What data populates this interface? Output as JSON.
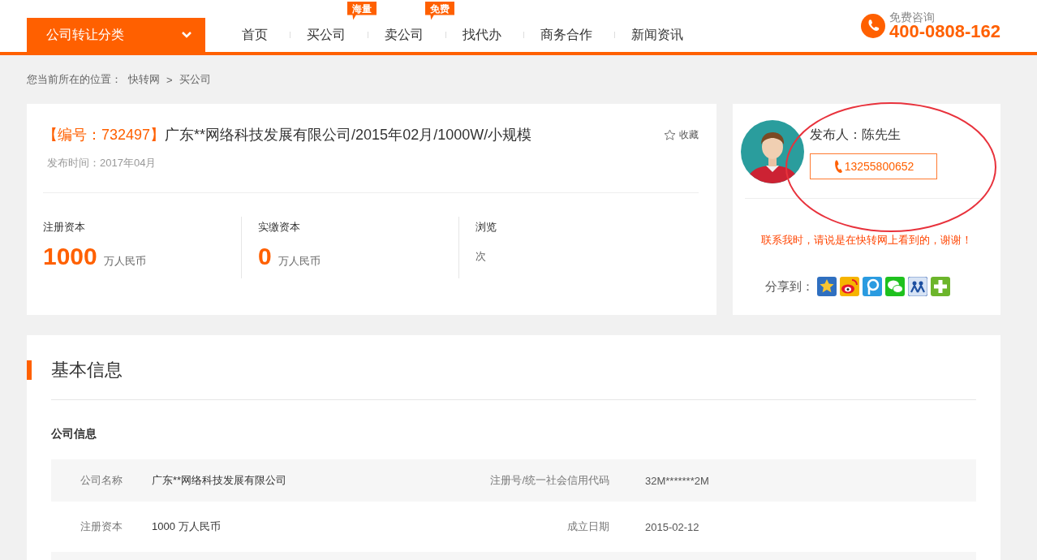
{
  "header": {
    "category_button": {
      "label": "公司转让分类"
    },
    "nav": [
      {
        "label": "首页"
      },
      {
        "label": "买公司",
        "badge": "海量"
      },
      {
        "label": "卖公司",
        "badge": "免费"
      },
      {
        "label": "找代办"
      },
      {
        "label": "商务合作"
      },
      {
        "label": "新闻资讯"
      }
    ],
    "hotline": {
      "caption": "免费咨询",
      "number": "400-0808-162"
    }
  },
  "breadcrumb": {
    "prefix": "您当前所在的位置：",
    "items": [
      "快转网",
      "买公司"
    ],
    "separator": ">"
  },
  "listing": {
    "number": "【编号：732497】",
    "title": "广东**网络科技发展有限公司/2015年02月/1000W/小规模",
    "favorite": "收藏",
    "published": "发布时间：2017年04月",
    "stats": [
      {
        "label": "注册资本",
        "value": "1000",
        "unit": "万人民币"
      },
      {
        "label": "实缴资本",
        "value": "0",
        "unit": "万人民币"
      },
      {
        "label": "浏览",
        "unit": "次"
      }
    ]
  },
  "publisher": {
    "name": "发布人：陈先生",
    "phone": "13255800652",
    "note": "联系我时，请说是在快转网上看到的，谢谢！",
    "share_label": "分享到：",
    "share_targets": [
      {
        "kind": "star"
      },
      {
        "kind": "weibo"
      },
      {
        "kind": "pin"
      },
      {
        "kind": "chat"
      },
      {
        "kind": "people"
      },
      {
        "kind": "plus"
      }
    ],
    "annotation": {
      "kind": "ellipse",
      "color": "#e8323c"
    }
  },
  "basic_info": {
    "title": "基本信息",
    "section": "公司信息",
    "rows": [
      {
        "cells": [
          {
            "label": "公司名称",
            "value": "广东**网络科技发展有限公司"
          },
          {
            "label": "注册号/统一社会信用代码",
            "value": "32M*******2M"
          }
        ]
      },
      {
        "cells": [
          {
            "label": "注册资本",
            "value": "1000 万人民币"
          },
          {
            "label": "成立日期",
            "value": "2015-02-12"
          }
        ]
      }
    ]
  }
}
